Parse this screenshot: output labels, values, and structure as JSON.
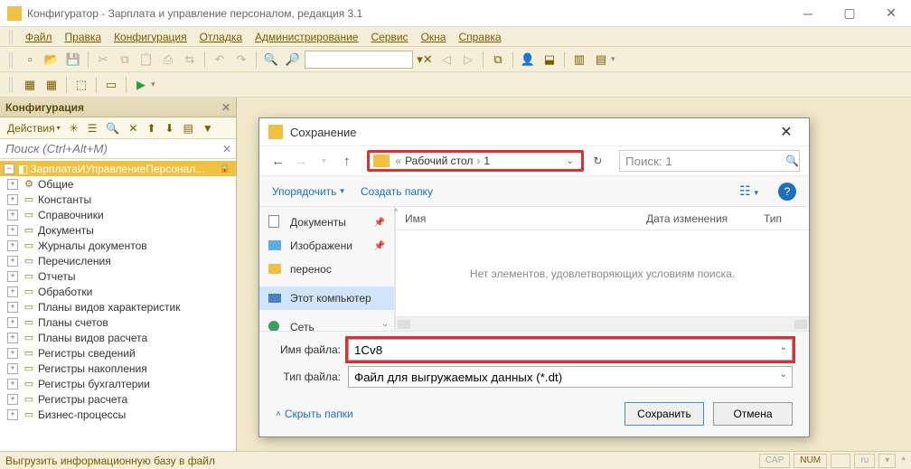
{
  "titlebar": {
    "title": "Конфигуратор - Зарплата и управление персоналом, редакция 3.1"
  },
  "menubar": {
    "items": [
      "Файл",
      "Правка",
      "Конфигурация",
      "Отладка",
      "Администрирование",
      "Сервис",
      "Окна",
      "Справка"
    ]
  },
  "toolbar1": {
    "search_value": ""
  },
  "config_panel": {
    "title": "Конфигурация",
    "actions_label": "Действия",
    "search_placeholder": "Поиск (Ctrl+Alt+M)"
  },
  "tree": {
    "root": "ЗарплатаИУправлениеПерсонал...",
    "items": [
      {
        "label": "Общие",
        "icon": "⚙"
      },
      {
        "label": "Константы",
        "icon": "▭"
      },
      {
        "label": "Справочники",
        "icon": "▭"
      },
      {
        "label": "Документы",
        "icon": "▭"
      },
      {
        "label": "Журналы документов",
        "icon": "▭"
      },
      {
        "label": "Перечисления",
        "icon": "▭"
      },
      {
        "label": "Отчеты",
        "icon": "▭"
      },
      {
        "label": "Обработки",
        "icon": "▭"
      },
      {
        "label": "Планы видов характеристик",
        "icon": "▭"
      },
      {
        "label": "Планы счетов",
        "icon": "▭"
      },
      {
        "label": "Планы видов расчета",
        "icon": "▭"
      },
      {
        "label": "Регистры сведений",
        "icon": "▭"
      },
      {
        "label": "Регистры накопления",
        "icon": "▭"
      },
      {
        "label": "Регистры бухгалтерии",
        "icon": "▭"
      },
      {
        "label": "Регистры расчета",
        "icon": "▭"
      },
      {
        "label": "Бизнес-процессы",
        "icon": "▭"
      }
    ]
  },
  "dialog": {
    "title": "Сохранение",
    "path": {
      "crumb1": "Рабочий стол",
      "crumb2": "1"
    },
    "search_value": "Поиск: 1",
    "organize": "Упорядочить",
    "new_folder": "Создать папку",
    "sidebar": [
      {
        "label": "Документы",
        "kind": "doc",
        "pinned": true
      },
      {
        "label": "Изображени",
        "kind": "img",
        "pinned": true
      },
      {
        "label": "перенос",
        "kind": "folder",
        "pinned": false
      },
      {
        "label": "Этот компьютер",
        "kind": "pc",
        "pinned": false
      },
      {
        "label": "Сеть",
        "kind": "net",
        "pinned": false
      }
    ],
    "columns": {
      "name": "Имя",
      "date": "Дата изменения",
      "type": "Тип"
    },
    "empty_text": "Нет элементов, удовлетворяющих условиям поиска.",
    "filename_label": "Имя файла:",
    "filename_value": "1Cv8",
    "filetype_label": "Тип файла:",
    "filetype_value": "Файл для выгружаемых данных (*.dt)",
    "hide_folders": "Скрыть папки",
    "save": "Сохранить",
    "cancel": "Отмена"
  },
  "statusbar": {
    "text": "Выгрузить информационную базу в файл",
    "cap": "CAP",
    "num": "NUM",
    "lang": "ru",
    "star": "*"
  }
}
